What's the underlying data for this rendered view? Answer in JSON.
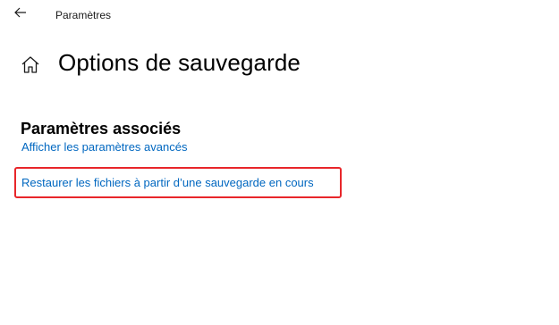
{
  "window": {
    "title": "Paramètres",
    "back_icon": "arrow-left-icon"
  },
  "page": {
    "home_icon": "home-icon",
    "title": "Options de sauvegarde"
  },
  "related_settings": {
    "heading": "Paramètres associés",
    "links": [
      {
        "label": "Afficher les paramètres avancés"
      },
      {
        "label": "Restaurer les fichiers à partir d’une sauvegarde en cours",
        "highlighted": true
      }
    ]
  },
  "colors": {
    "link": "#0067c0",
    "highlight_border": "#e8262a",
    "background": "#ffffff"
  }
}
